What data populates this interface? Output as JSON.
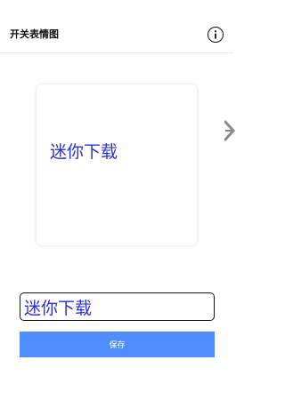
{
  "header": {
    "title": "开关表情图"
  },
  "icons": {
    "info": "info-circle-icon",
    "edge": "close-x-icon"
  },
  "preview": {
    "text": "迷你下载",
    "text_color": "#2b2fd6"
  },
  "input": {
    "value": "迷你下载"
  },
  "save_button": {
    "label": "保存",
    "color": "#4f8dfc"
  }
}
